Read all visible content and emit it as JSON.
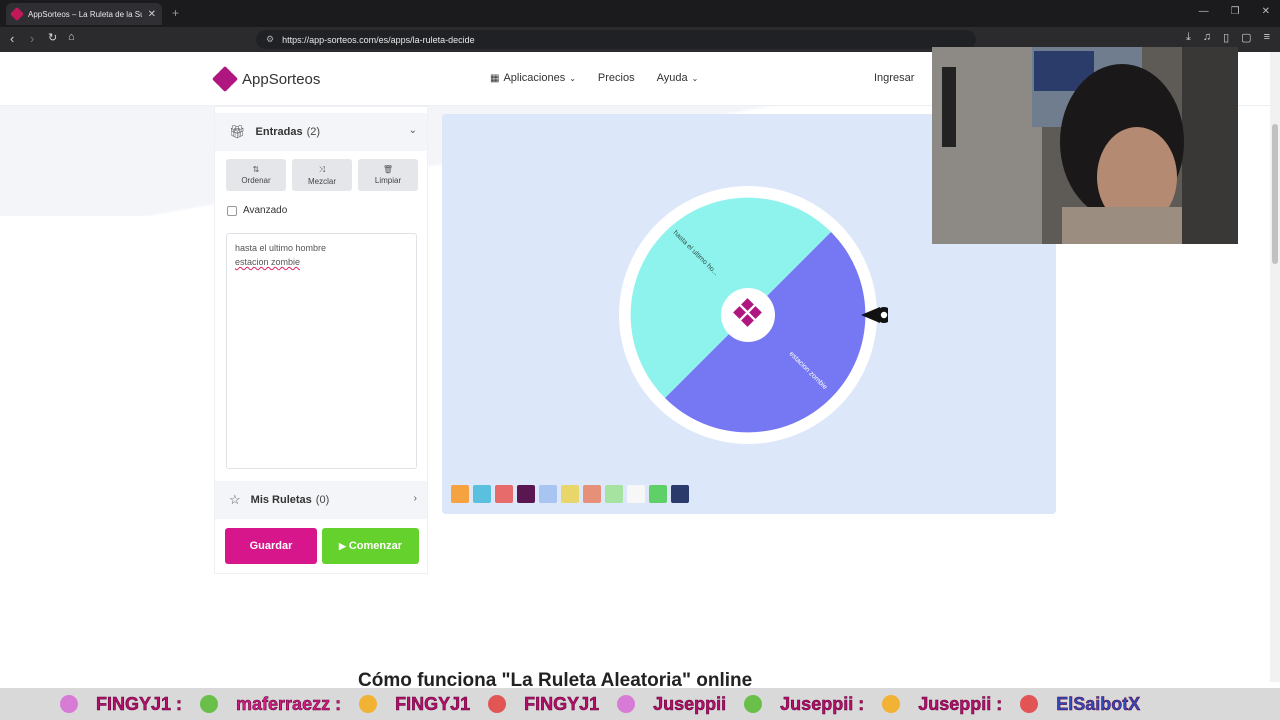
{
  "browser": {
    "tab_title": "AppSorteos – La Ruleta de la Su",
    "url": "https://app-sorteos.com/es/apps/la-ruleta-decide"
  },
  "site": {
    "brand": "AppSorteos",
    "nav": {
      "aplicaciones": "Aplicaciones",
      "precios": "Precios",
      "ayuda": "Ayuda",
      "ingresar": "Ingresar"
    }
  },
  "panel": {
    "entradas_label": "Entradas",
    "entradas_count": "(2)",
    "tools": {
      "ordenar": "Ordenar",
      "mezclar": "Mezclar",
      "limpiar": "Limpiar"
    },
    "avanzado": "Avanzado",
    "entries": [
      "hasta el ultimo hombre",
      "estacion zombie"
    ],
    "mis_ruletas_label": "Mis Ruletas",
    "mis_ruletas_count": "(0)",
    "guardar": "Guardar",
    "comenzar": "Comenzar"
  },
  "wheel": {
    "segments": [
      {
        "label": "hasta el ultimo ho...",
        "color": "#8ef3ec"
      },
      {
        "label": "estacion zombie",
        "color": "#7578f2"
      }
    ]
  },
  "palette_colors": [
    "#f4a340",
    "#5bc0de",
    "#e86b6b",
    "#5a1650",
    "#a8c4f0",
    "#e8d66a",
    "#e6907a",
    "#a6e3a1",
    "#f7f7f7",
    "#5fd068",
    "#2a3a6a"
  ],
  "section_title": "Cómo funciona \"La Ruleta Aleatoria\" online",
  "chat": [
    "FINGYJ1 :",
    "maferraezz :",
    "FINGYJ1",
    "FINGYJ1",
    "Juseppii",
    "Juseppii :",
    "Juseppii :",
    "ElSaibotX"
  ],
  "colors": {
    "brand": "#b0167f",
    "save": "#d6168a",
    "start": "#64d12d",
    "wheel_bg": "#dce7fa"
  }
}
